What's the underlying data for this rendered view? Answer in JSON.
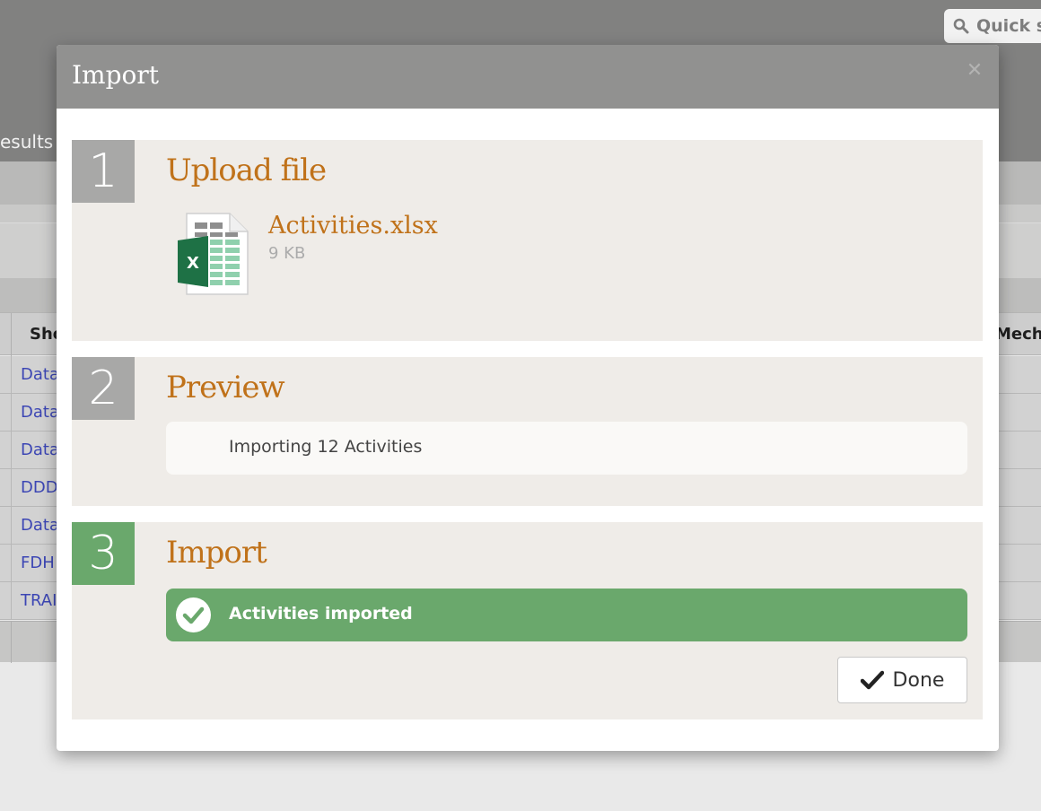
{
  "background": {
    "quick_search_placeholder": "Quick s",
    "tab_label": "esults",
    "table_headers": [
      "Sho",
      "Mecha"
    ],
    "table_rows": [
      "Data",
      "Data",
      "Data",
      "DDD",
      "Data",
      "FDH",
      "TRAI"
    ]
  },
  "modal": {
    "title": "Import",
    "close_icon": "close-icon",
    "steps": [
      {
        "number": "1",
        "title": "Upload file",
        "file": {
          "name": "Activities.xlsx",
          "size": "9 KB",
          "icon": "excel-file-icon"
        }
      },
      {
        "number": "2",
        "title": "Preview",
        "message": "Importing 12 Activities"
      },
      {
        "number": "3",
        "title": "Import",
        "status": "Activities imported",
        "status_icon": "check-circle-icon",
        "done_label": "Done"
      }
    ]
  },
  "colors": {
    "accent_orange": "#c0721a",
    "success_green": "#6aa86c",
    "step_grey": "#a8a8a7",
    "header_grey": "#919190"
  }
}
